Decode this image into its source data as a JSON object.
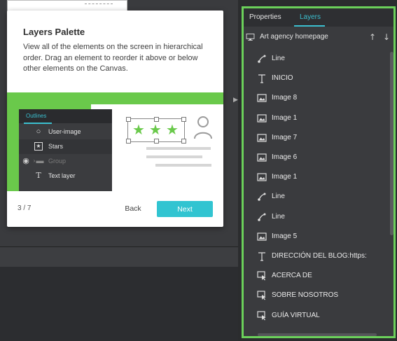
{
  "tour": {
    "title": "Layers Palette",
    "description": "View all of the elements on the screen in hierarchical order. Drag an element to reorder it above or below other elements on the Canvas.",
    "step": "3 / 7",
    "back_label": "Back",
    "next_label": "Next",
    "illustration": {
      "outlines_tab": "Outlines",
      "rows": [
        {
          "icon": "circle-icon",
          "label": "User-image",
          "selected": false,
          "dim": false
        },
        {
          "icon": "star-icon",
          "label": "Stars",
          "selected": true,
          "dim": false
        },
        {
          "icon": "folder-icon",
          "label": "Group",
          "selected": false,
          "dim": true
        },
        {
          "icon": "text-icon",
          "label": "Text layer",
          "selected": false,
          "dim": false
        }
      ]
    }
  },
  "panel": {
    "tabs": [
      "Properties",
      "Layers"
    ],
    "active_tab": "Layers",
    "page_name": "Art agency homepage",
    "layers": [
      {
        "icon": "line-icon",
        "label": "Line"
      },
      {
        "icon": "text-icon",
        "label": "INICIO"
      },
      {
        "icon": "image-icon",
        "label": "Image 8"
      },
      {
        "icon": "image-icon",
        "label": "Image 1"
      },
      {
        "icon": "image-icon",
        "label": "Image 7"
      },
      {
        "icon": "image-icon",
        "label": "Image 6"
      },
      {
        "icon": "image-icon",
        "label": "Image 1"
      },
      {
        "icon": "line-icon",
        "label": "Line"
      },
      {
        "icon": "line-icon",
        "label": "Line"
      },
      {
        "icon": "image-icon",
        "label": "Image 5"
      },
      {
        "icon": "text-icon",
        "label": "DIRECCIÓN DEL BLOG:https:"
      },
      {
        "icon": "hotspot-icon",
        "label": "ACERCA DE"
      },
      {
        "icon": "hotspot-icon",
        "label": "SOBRE NOSOTROS"
      },
      {
        "icon": "hotspot-icon",
        "label": "GUÍA VIRTUAL"
      }
    ]
  },
  "colors": {
    "accent": "#31c4d1",
    "highlight": "#6bd05a",
    "panel_bg": "#3a3b3e"
  }
}
